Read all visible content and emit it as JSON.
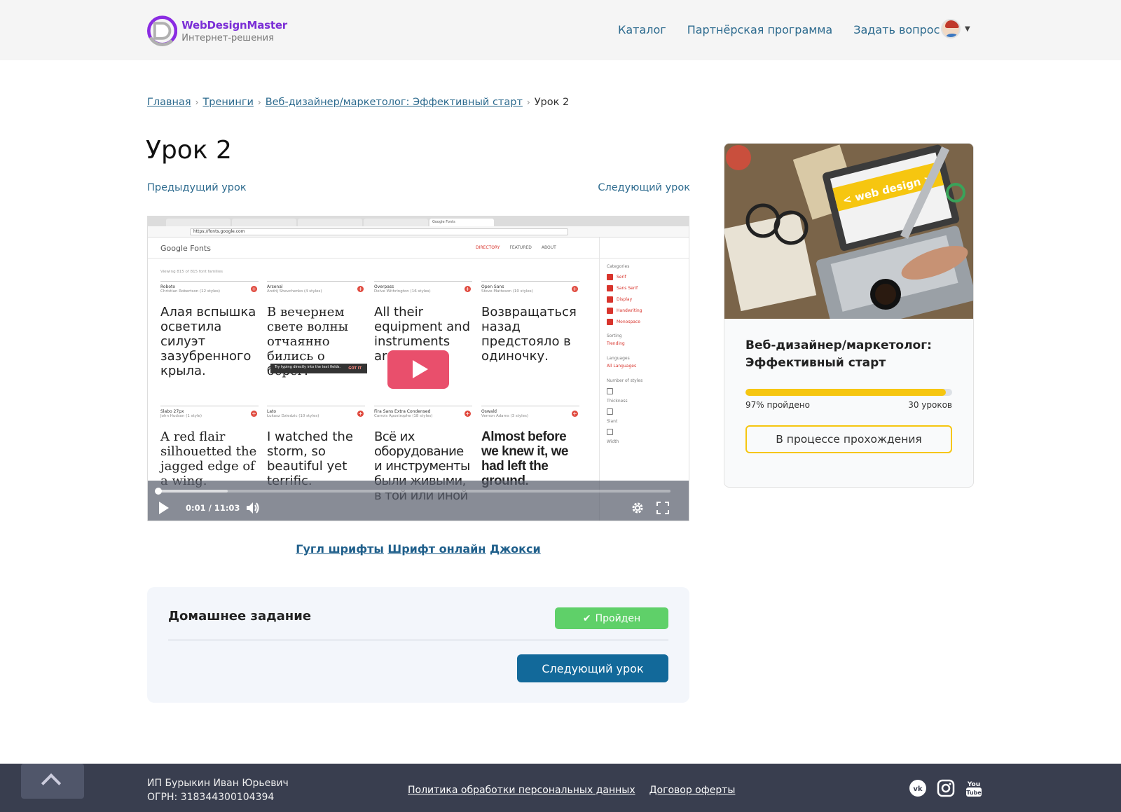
{
  "header": {
    "logo_name": "WebDesignMaster",
    "logo_sub": "Интернет-решения",
    "nav": [
      "Каталог",
      "Партнёрская программа",
      "Задать вопрос"
    ]
  },
  "breadcrumb": {
    "items": [
      "Главная",
      "Тренинги",
      "Веб-дизайнер/маркетолог: Эффективный старт"
    ],
    "current": "Урок 2"
  },
  "page": {
    "title": "Урок 2",
    "prev_label": "Предыдущий урок",
    "next_label": "Следующий урок"
  },
  "video": {
    "time": "0:01 / 11:03",
    "progress": 0.0015,
    "screen": {
      "url": "https://fonts.google.com",
      "gf_logo": "Google Fonts",
      "gf_nav": [
        "DIRECTORY",
        "FEATURED",
        "ABOUT"
      ],
      "count": "Viewing 815 of 815 font families",
      "side": {
        "categories_label": "Categories",
        "categories": [
          "Serif",
          "Sans Serif",
          "Display",
          "Handwriting",
          "Monospace"
        ],
        "sorting_label": "Sorting",
        "sorting": "Trending",
        "languages_label": "Languages",
        "languages": "All Languages",
        "filters": [
          "Number of styles",
          "Thickness",
          "Slant",
          "Width"
        ]
      },
      "tooltip": "Try typing directly into the text fields.",
      "tooltip_btn": "GOT IT",
      "cards": [
        {
          "name": "Roboto",
          "author": "Christian Robertson (12 styles)",
          "sample": "Алая вспышка осветила силуэт зазубренного крыла."
        },
        {
          "name": "Arsenal",
          "author": "Andrij Shevchenko (4 styles)",
          "sample": "В вечернем свете волны отчаянно бились о берег."
        },
        {
          "name": "Overpass",
          "author": "Delve Withrington (16 styles)",
          "sample": "All their equipment and instruments are alive."
        },
        {
          "name": "Open Sans",
          "author": "Steve Matteson (10 styles)",
          "sample": "Возвращаться назад предстояло в одиночку."
        },
        {
          "name": "Slabo 27px",
          "author": "John Hudson (1 style)",
          "sample": "A red flair silhouetted the jagged edge of a wing."
        },
        {
          "name": "Lato",
          "author": "Łukasz Dziedzic (10 styles)",
          "sample": "I watched the storm, so beautiful yet terrific."
        },
        {
          "name": "Fira Sans Extra Condensed",
          "author": "Carrois Apostrophe (18 styles)",
          "sample": "Всё их оборудование и инструменты были живыми, в той или иной"
        },
        {
          "name": "Oswald",
          "author": "Vernon Adams (3 styles)",
          "sample": "Almost before we knew it, we had left the ground."
        }
      ]
    }
  },
  "links": [
    "Гугл шрифты",
    "Шрифт онлайн",
    "Джокси"
  ],
  "homework": {
    "title": "Домашнее задание",
    "badge": "Пройден",
    "next_button": "Следующий урок"
  },
  "course": {
    "title": "Веб-дизайнер/маркетолог: Эффективный старт",
    "progress_percent": 97,
    "progress_label": "97% пройдено",
    "lessons_label": "30 уроков",
    "status": "В процессе прохождения",
    "image_text": "< web design >"
  },
  "footer": {
    "owner": "ИП Бурыкин Иван Юрьевич",
    "ogrn": "ОГРН: 318344300104394",
    "links": [
      "Политика обработки персональных данных",
      "Договор оферты"
    ],
    "social": [
      "vk-icon",
      "instagram-icon",
      "youtube-icon"
    ]
  }
}
